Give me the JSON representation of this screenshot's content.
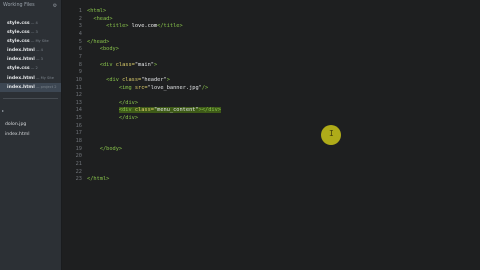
{
  "sidebar": {
    "header": "Working Files",
    "files": [
      {
        "name": "style.css",
        "sub": " — 4"
      },
      {
        "name": "style.css",
        "sub": " — 3"
      },
      {
        "name": "style.css",
        "sub": " — My Site"
      },
      {
        "name": "index.html",
        "sub": " — 4"
      },
      {
        "name": "index.html",
        "sub": " — 3"
      },
      {
        "name": "style.css",
        "sub": " — 2"
      },
      {
        "name": "index.html",
        "sub": " — My Site"
      },
      {
        "name": "index.html",
        "sub": " — project 2"
      }
    ],
    "project_icon": "▸",
    "project_files": [
      "dolon.jpg",
      "index.html"
    ]
  },
  "editor": {
    "line_numbers": [
      "1",
      "2",
      "3",
      "4",
      "5",
      "6",
      "7",
      "8",
      "9",
      "10",
      "11",
      "12",
      "13",
      "14",
      "15",
      "16",
      "17",
      "18",
      "19",
      "20",
      "21",
      "22",
      "23"
    ],
    "lines": {
      "l1": {
        "o": "<html>"
      },
      "l2": {
        "o": "<head>"
      },
      "l3": {
        "o": "<title>",
        "t": " love.com",
        "c": "</title>"
      },
      "l5": {
        "o": "</head>"
      },
      "l6": {
        "o": "<body>"
      },
      "l8": {
        "o": "<div ",
        "a": "class=",
        "s": "\"main\"",
        "e": ">"
      },
      "l10": {
        "o": "<div ",
        "a": "class=",
        "s": "\"header\"",
        "e": ">"
      },
      "l11": {
        "o": "<img ",
        "a": "src=",
        "s": "\"love_banner.jpg\"",
        "e": "/>"
      },
      "l12": {
        "o": "</div>"
      },
      "l13": {
        "o": "<div ",
        "a": "class=",
        "s": "\"menu_content\"",
        "e": "></div>"
      },
      "l14": {
        "o": "</div>"
      },
      "l17": {
        "o": "</body>"
      },
      "l21": {
        "o": "</html>"
      }
    },
    "cursor_glyph": "I"
  },
  "colors": {
    "tag": "#88c34b",
    "attr": "#dfd06b",
    "highlight": "#3e5a18",
    "cursor": "#c9c418"
  }
}
